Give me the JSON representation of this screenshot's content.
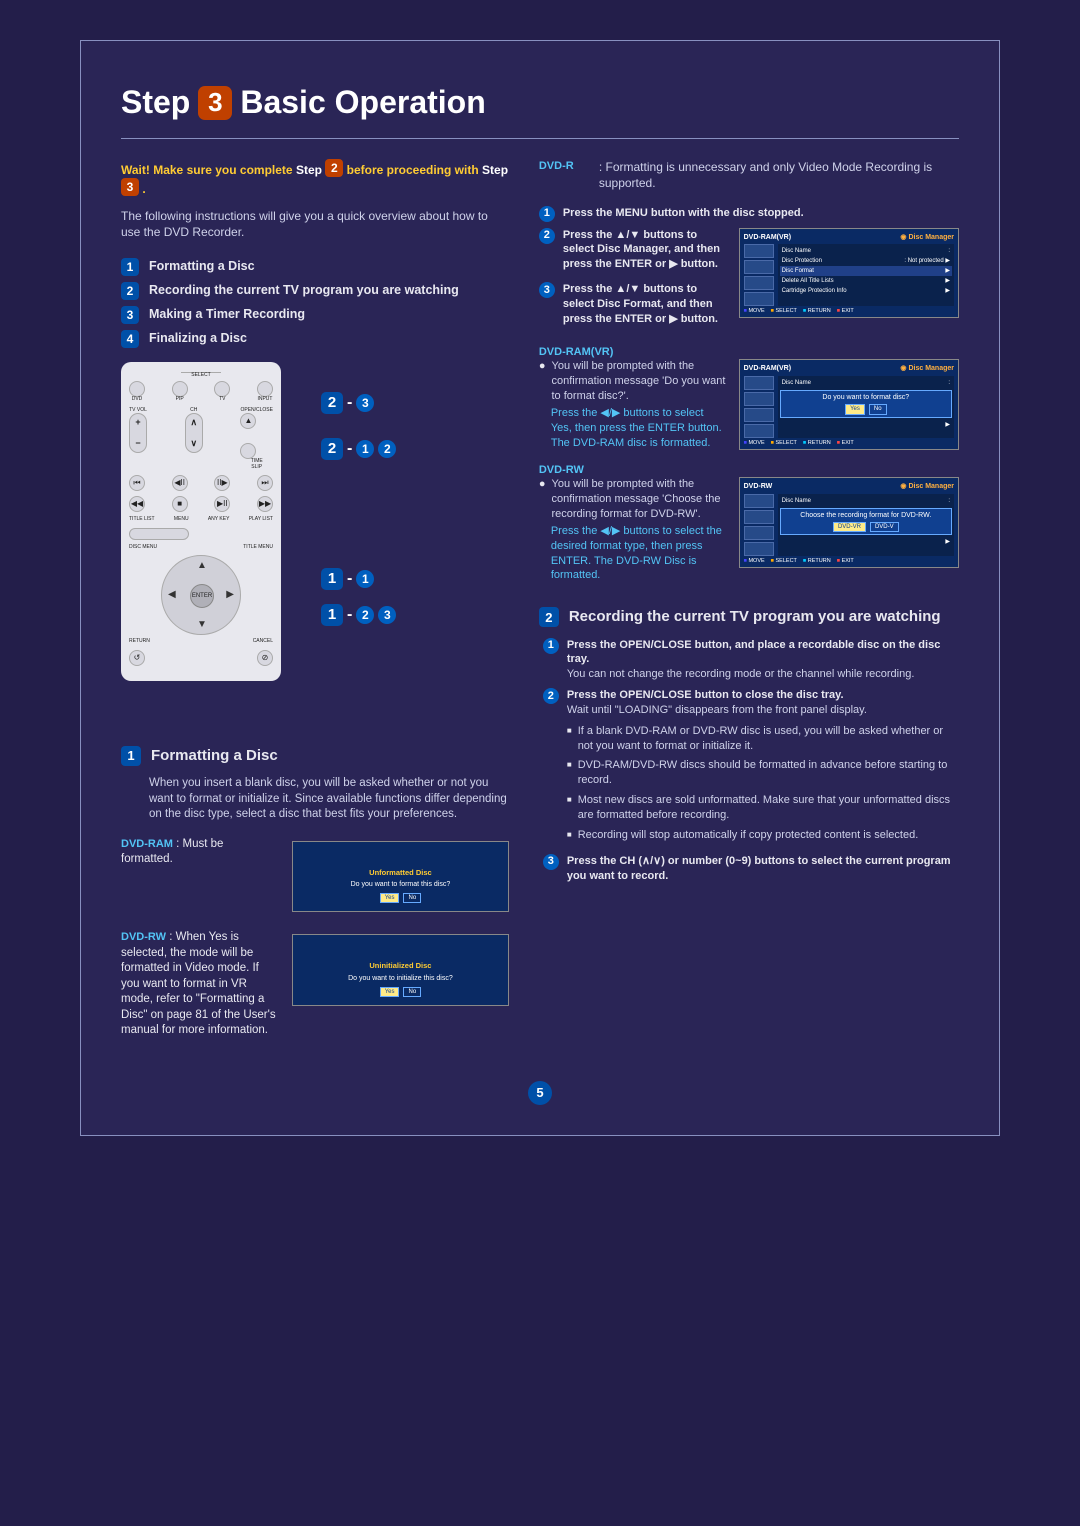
{
  "title": {
    "step_word": "Step",
    "step_number": "3",
    "rest": "Basic Operation"
  },
  "warning": {
    "prefix": "Wait! Make sure you complete",
    "step_word": "Step",
    "step_num_before": "2",
    "mid": "before proceeding with",
    "step_num_after": "3",
    "period": "."
  },
  "intro": "The following instructions will give you a quick overview about how to use the DVD Recorder.",
  "toc": [
    {
      "n": "1",
      "label": "Formatting a Disc"
    },
    {
      "n": "2",
      "label": "Recording the current TV program you are watching"
    },
    {
      "n": "3",
      "label": "Making a Timer Recording"
    },
    {
      "n": "4",
      "label": "Finalizing a Disc"
    }
  ],
  "remote_labels": {
    "select": "SELECT",
    "dvd": "DVD",
    "pip": "PIP",
    "tv": "TV",
    "input": "INPUT",
    "tvvol": "TV VOL",
    "ch": "CH",
    "openclose": "OPEN/CLOSE",
    "timeslip": "TIME\nSLIP",
    "titlelist": "TITLE LIST",
    "menu": "MENU",
    "anykey": "ANY KEY",
    "playlist": "PLAY LIST",
    "discmenu": "DISC MENU",
    "titlemenu": "TITLE MENU",
    "return": "RETURN",
    "cancel": "CANCEL",
    "enter": "ENTER"
  },
  "callouts": [
    {
      "sq": "2",
      "dash": "-",
      "ci": [
        "3"
      ]
    },
    {
      "sq": "2",
      "dash": "-",
      "ci": [
        "1",
        "2"
      ]
    },
    {
      "sq": "1",
      "dash": "-",
      "ci": [
        "1"
      ]
    },
    {
      "sq": "1",
      "dash": "-",
      "ci": [
        "2",
        "3"
      ]
    }
  ],
  "section1": {
    "n": "1",
    "title": "Formatting a Disc",
    "body": "When you insert a blank disc, you will be asked whether or not you want to format or initialize it. Since available functions differ depending on the disc type, select a disc that best fits your preferences.",
    "dvd_ram_label": "DVD-RAM",
    "dvd_ram_text": ": Must be formatted.",
    "dvd_rw_label": "DVD-RW",
    "dvd_rw_text": ": When Yes is selected, the mode will be formatted in Video mode. If you want to format in VR mode, refer to \"Formatting a Disc\" on page 81 of the User's manual for more information.",
    "shot1": {
      "line1": "Unformatted Disc",
      "line2": "Do you want to format this disc?",
      "yes": "Yes",
      "no": "No"
    },
    "shot2": {
      "line1": "Uninitialized Disc",
      "line2": "Do you want to initialize this disc?",
      "yes": "Yes",
      "no": "No"
    }
  },
  "right_dvdr": {
    "label": "DVD-R",
    "text": ": Formatting is unnecessary and only Video Mode Recording is supported."
  },
  "right_steps": [
    {
      "n": "1",
      "html": "Press the <b>MENU</b> button with the disc stopped."
    },
    {
      "n": "2",
      "html": "Press the ▲/▼ buttons to select Disc Manager, and then press the ENTER or ▶ button."
    },
    {
      "n": "3",
      "html": "Press the ▲/▼ buttons to select Disc Format, and then press the ENTER or ▶ button."
    }
  ],
  "osd_manager": {
    "title_left": "DVD-RAM(VR)",
    "title_right": "Disc Manager",
    "rows": [
      {
        "l": "Disc Name",
        "r": ":"
      },
      {
        "l": "Disc Protection",
        "r": ": Not protected  ▶"
      },
      {
        "l": "Disc Format",
        "r": "▶",
        "hl": true
      },
      {
        "l": "Delete All Title Lists",
        "r": "▶"
      },
      {
        "l": "Cartridge Protection Info",
        "r": "▶"
      }
    ],
    "footer": [
      "MOVE",
      "SELECT",
      "RETURN",
      "EXIT"
    ]
  },
  "ram_vr": {
    "label": "DVD-RAM(VR)",
    "bullet": "You will be prompted with the confirmation message 'Do you want to format disc?'.",
    "tail": "Press the ◀/▶ buttons to select Yes, then press the ENTER button. The DVD-RAM disc is formatted.",
    "osd": {
      "title_left": "DVD-RAM(VR)",
      "title_right": "Disc Manager",
      "row_label": "Disc Name",
      "prompt": "Do you want to format disc?",
      "yes": "Yes",
      "no": "No",
      "footer": [
        "MOVE",
        "SELECT",
        "RETURN",
        "EXIT"
      ]
    }
  },
  "dvd_rw": {
    "label": "DVD-RW",
    "bullet": "You will be prompted with the confirmation message 'Choose the recording format for DVD-RW'.",
    "tail": "Press the ◀/▶ buttons to select the desired format type, then press ENTER. The DVD-RW Disc is formatted.",
    "osd": {
      "title_left": "DVD-RW",
      "title_right": "Disc Manager",
      "row_label": "Disc Name",
      "prompt": "Choose the recording format for DVD-RW.",
      "opt1": "DVD-VR",
      "opt2": "DVD-V",
      "footer": [
        "MOVE",
        "SELECT",
        "RETURN",
        "EXIT"
      ]
    }
  },
  "section2": {
    "n": "2",
    "title": "Recording the current TV program you are watching",
    "steps": [
      {
        "n": "1",
        "html": "<b>Press the OPEN/CLOSE button, and place a recordable disc on the disc tray.</b>",
        "sub": "You can not change the recording mode or the channel while recording."
      },
      {
        "n": "2",
        "html": "<b>Press the OPEN/CLOSE button to close the disc tray.</b>",
        "sub": "Wait until \"LOADING\" disappears from the front panel display.",
        "bullets": [
          "If a blank DVD-RAM or DVD-RW disc is used, you will be asked whether or not you want to format or initialize it.",
          "DVD-RAM/DVD-RW discs should be formatted in advance before starting to record.",
          "Most new discs are sold unformatted. Make sure that your unformatted discs are formatted before recording.",
          "Recording will stop automatically if copy protected content is selected."
        ]
      },
      {
        "n": "3",
        "html": "<b>Press the CH (∧/∨) or number (0~9) buttons to select the current program you want to record.</b>"
      }
    ]
  },
  "page_number": "5"
}
